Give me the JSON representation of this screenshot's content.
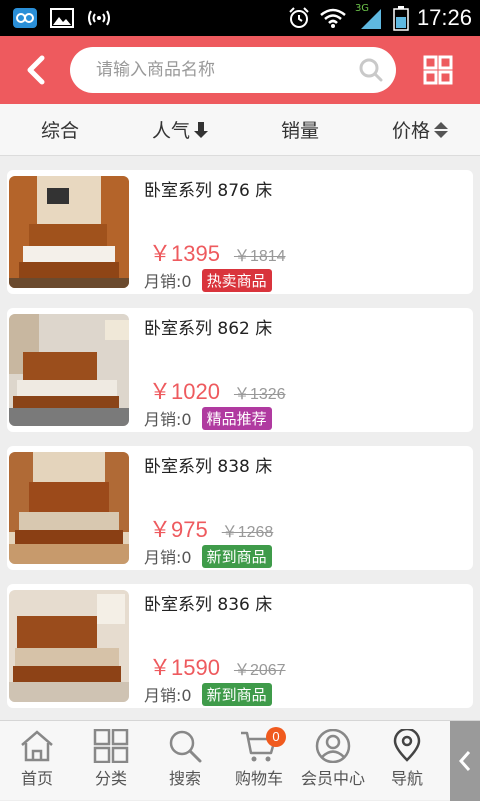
{
  "status_bar": {
    "time": "17:26",
    "network": "3G"
  },
  "header": {
    "search_placeholder": "请输入商品名称"
  },
  "sort": {
    "items": [
      "综合",
      "人气",
      "销量",
      "价格"
    ]
  },
  "products": [
    {
      "title": "卧室系列 876 床",
      "price": "￥1395",
      "old_price": "￥1814",
      "sales_label": "月销:",
      "sales": "0",
      "badge": "热卖商品",
      "badge_color": "#d9343c",
      "image": "bedroom-bed-photo"
    },
    {
      "title": "卧室系列 862 床",
      "price": "￥1020",
      "old_price": "￥1326",
      "sales_label": "月销:",
      "sales": "0",
      "badge": "精品推荐",
      "badge_color": "#b03aa0",
      "image": "bedroom-bed-photo"
    },
    {
      "title": "卧室系列 838 床",
      "price": "￥975",
      "old_price": "￥1268",
      "sales_label": "月销:",
      "sales": "0",
      "badge": "新到商品",
      "badge_color": "#3f9b4a",
      "image": "bedroom-bed-photo"
    },
    {
      "title": "卧室系列 836 床",
      "price": "￥1590",
      "old_price": "￥2067",
      "sales_label": "月销:",
      "sales": "0",
      "badge": "新到商品",
      "badge_color": "#3f9b4a",
      "image": "bedroom-bed-photo"
    }
  ],
  "bottom_nav": {
    "items": [
      {
        "label": "首页",
        "icon": "home-icon"
      },
      {
        "label": "分类",
        "icon": "category-icon"
      },
      {
        "label": "搜索",
        "icon": "search-icon"
      },
      {
        "label": "购物车",
        "icon": "cart-icon"
      },
      {
        "label": "会员中心",
        "icon": "user-icon"
      },
      {
        "label": "导航",
        "icon": "location-icon"
      }
    ],
    "cart_count": "0"
  },
  "colors": {
    "accent": "#ee5a5e",
    "price": "#ee5a5e"
  }
}
